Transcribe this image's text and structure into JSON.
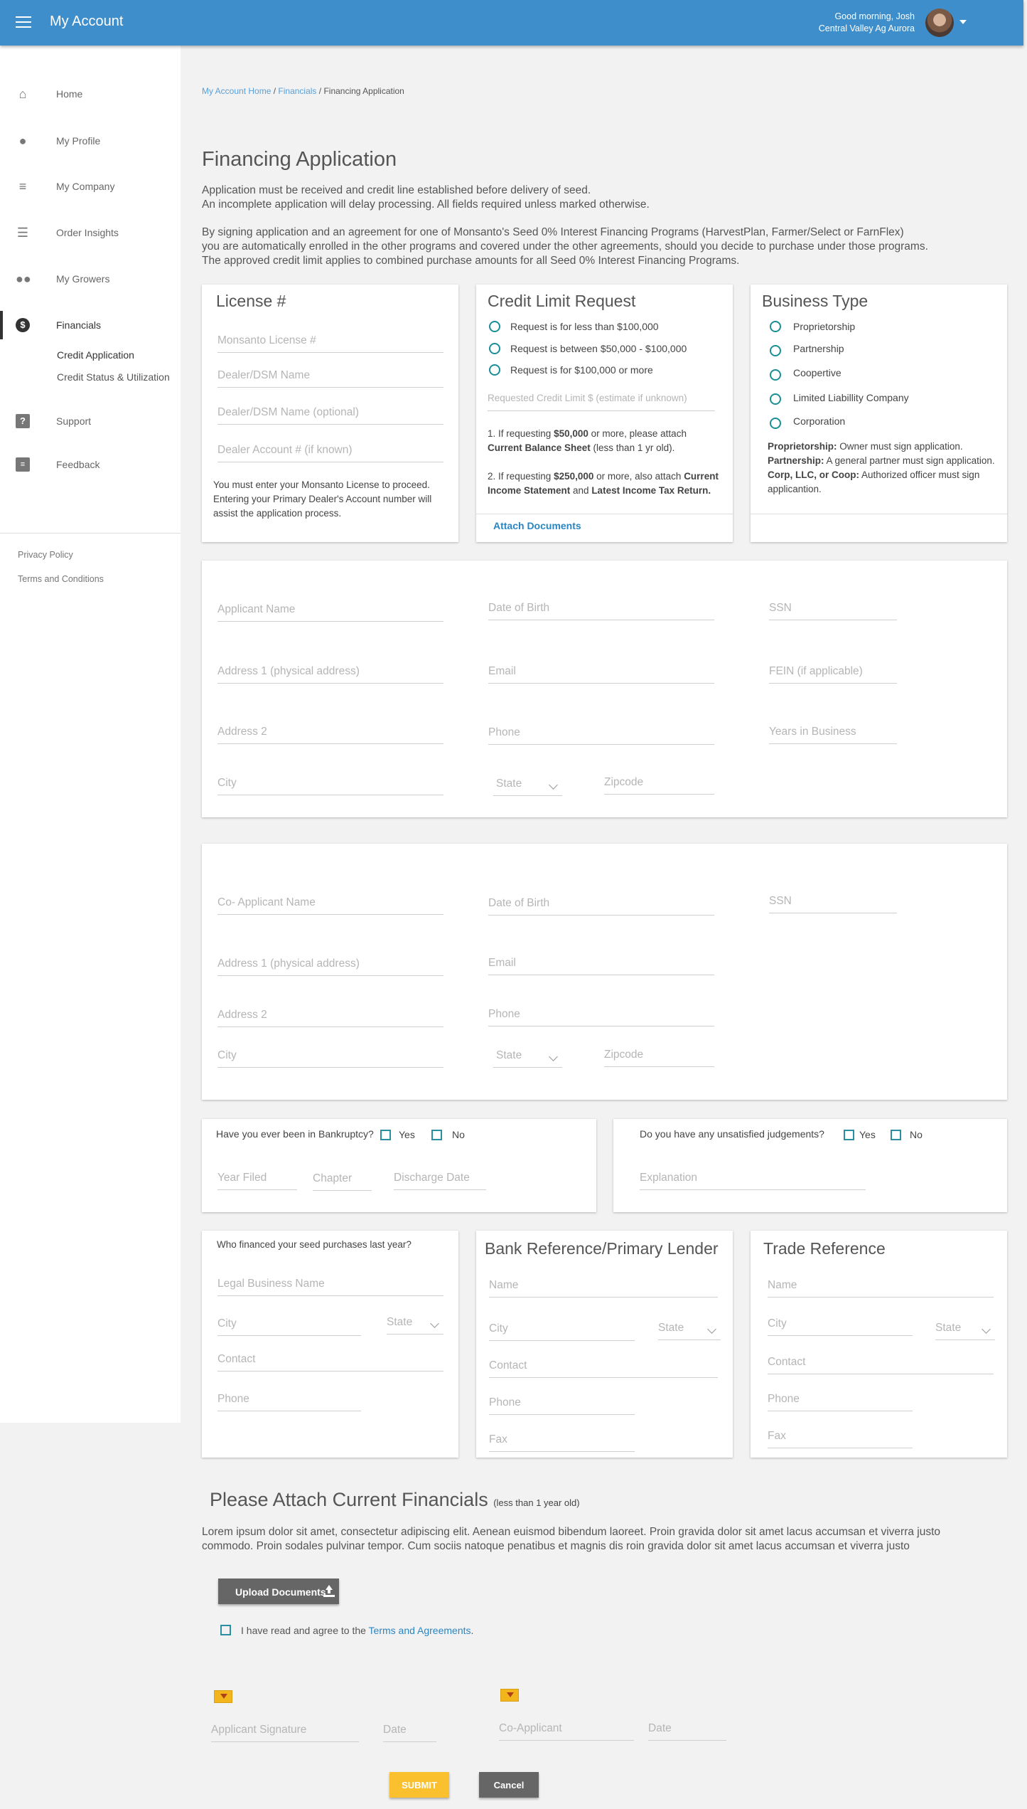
{
  "header": {
    "app_title": "My Account",
    "greeting": "Good morning, Josh",
    "company": "Central Valley Ag Aurora"
  },
  "sidebar": {
    "items": [
      {
        "label": "Home",
        "icon": "home-icon"
      },
      {
        "label": "My Profile",
        "icon": "person-icon"
      },
      {
        "label": "My Company",
        "icon": "filter-icon"
      },
      {
        "label": "Order Insights",
        "icon": "list-icon"
      },
      {
        "label": "My Growers",
        "icon": "people-icon"
      },
      {
        "label": "Financials",
        "icon": "dollar-icon"
      },
      {
        "label": "Support",
        "icon": "help-icon"
      },
      {
        "label": "Feedback",
        "icon": "chat-icon"
      }
    ],
    "sub_items": [
      "Credit Application",
      "Credit  Status & Utilization"
    ],
    "footer_links": [
      "Privacy  Policy",
      "Terms and Conditions"
    ]
  },
  "breadcrumb": {
    "home": "My Account Home",
    "financials": "Financials",
    "current": "/ Financing Application",
    "sep": "/"
  },
  "page": {
    "title": "Financing Application",
    "intro1": "Application must be received and credit line established before delivery of seed.",
    "intro2": "An incomplete application will delay processing. All fields required unless marked otherwise.",
    "intro3": "By signing application and an agreement for one of Monsanto's Seed 0% Interest Financing Programs (HarvestPlan, Farmer/Select or FarnFlex)",
    "intro4": "you are automatically enrolled in the other programs and covered under the other agreements, should you decide to purchase under those programs.",
    "intro5": "The approved credit limit applies to combined purchase amounts for all Seed 0% Interest Financing Programs."
  },
  "license": {
    "title": "License #",
    "fields": [
      "Monsanto License #",
      "Dealer/DSM Name",
      "Dealer/DSM Name (optional)",
      "Dealer Account # (if known)"
    ],
    "note": "You must enter your Monsanto License to proceed. Entering your Primary Dealer's Account number will assist the application process."
  },
  "credit": {
    "title": "Credit Limit Request",
    "options": [
      "Request is for less than $100,000",
      "Request is between $50,000 - $100,000",
      "Request is for $100,000 or more"
    ],
    "limit_placeholder": "Requested Credit Limit $ (estimate if unknown)",
    "n1a": "1. If requesting ",
    "n1b": "$50,000",
    "n1c": " or more, please attach ",
    "n1d": "Current Balance  Sheet",
    "n1e": " (less than 1 yr old).",
    "n2a": "2. If requesting ",
    "n2b": "$250,000",
    "n2c": " or more, also attach ",
    "n2d": "Current Income Statement",
    "n2e": " and ",
    "n2f": "Latest Income Tax Return.",
    "attach": "Attach Documents"
  },
  "business": {
    "title": "Business Type",
    "options": [
      "Proprietorship",
      "Partnership",
      "Coopertive",
      "Limited Liabillity Company",
      "Corporation"
    ],
    "d1b": "Proprietorship:",
    "d1": " Owner must sign application.",
    "d2b": "Partnership:",
    "d2": " A general partner must sign application.",
    "d3b": "Corp, LLC, or Coop:",
    "d3": " Authorized officer must sign applicantion."
  },
  "applicant": {
    "name": "Applicant Name",
    "dob": "Date of Birth",
    "ssn": "SSN",
    "addr1": "Address 1 (physical address)",
    "email": "Email",
    "fein": "FEIN (if applicable)",
    "addr2": "Address 2",
    "phone": "Phone",
    "years": "Years in Business",
    "city": "City",
    "state": "State",
    "zip": "Zipcode"
  },
  "coapplicant": {
    "name": "Co- Applicant Name",
    "dob": "Date of Birth",
    "ssn": "SSN",
    "addr1": "Address 1 (physical address)",
    "email": "Email",
    "addr2": "Address 2",
    "phone": "Phone",
    "city": "City",
    "state": "State",
    "zip": "Zipcode"
  },
  "bankruptcy": {
    "question": "Have you ever been in Bankruptcy?",
    "yes": "Yes",
    "no": "No",
    "year": "Year Filed",
    "chapter": "Chapter",
    "discharge": "Discharge Date"
  },
  "judgements": {
    "question": "Do you have any unsatisfied judgements?",
    "yes": "Yes",
    "no": "No",
    "explanation": "Explanation"
  },
  "financer": {
    "question": "Who financed your seed purchases last year?",
    "legal": "Legal Business Name",
    "city": "City",
    "state": "State",
    "contact": "Contact",
    "phone": "Phone"
  },
  "bank": {
    "title": "Bank Reference/Primary Lender",
    "name": "Name",
    "city": "City",
    "state": "State",
    "contact": "Contact",
    "phone": "Phone",
    "fax": "Fax"
  },
  "trade": {
    "title": "Trade Reference",
    "name": "Name",
    "city": "City",
    "state": "State",
    "contact": "Contact",
    "phone": "Phone",
    "fax": "Fax"
  },
  "attach": {
    "title": "Please Attach Current Financials",
    "sub": "(less than 1 year old)",
    "lorem1": "Lorem ipsum dolor sit amet, consectetur adipiscing elit. Aenean euismod bibendum laoreet. Proin gravida dolor sit amet lacus accumsan et viverra justo",
    "lorem2": "commodo. Proin sodales pulvinar tempor. Cum sociis natoque penatibus et magnis dis roin gravida dolor sit amet lacus accumsan et viverra justo",
    "upload": "Upload Documents",
    "agree": "I have read and agree to the ",
    "terms": "Terms and Agreements",
    "period": "."
  },
  "signature": {
    "applicant": "Applicant Signature",
    "date": "Date",
    "co": "Co-Applicant",
    "co_date": "Date"
  },
  "actions": {
    "submit": "SUBMIT",
    "cancel": "Cancel"
  },
  "colors": {
    "header": "#3d8ecb",
    "accent": "#1a8e96",
    "submit": "#fbc02d",
    "cancel": "#666666"
  }
}
